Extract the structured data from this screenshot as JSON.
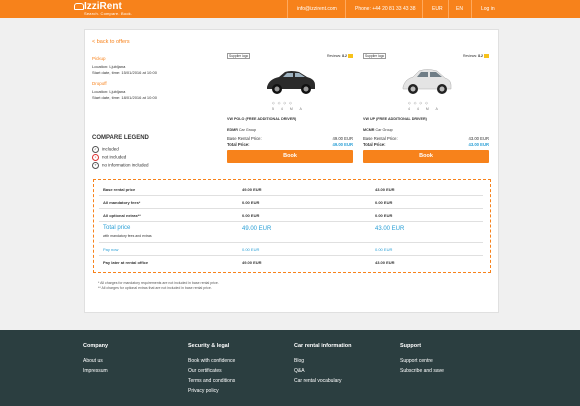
{
  "header": {
    "brand": "IzziRent",
    "tagline": "Search. Compare. Book.",
    "email": "info@izzirent.com",
    "phone": "Phone: +44 20 81 33 43 38",
    "currency": "EUR",
    "language": "EN",
    "login": "Log in"
  },
  "back_link": "< back to offers",
  "pickup": {
    "title": "Pickup",
    "location": "Location: Ljubljana",
    "datetime": "Start date, time: 15/01/2016 at 10:00"
  },
  "dropoff": {
    "title": "Dropoff",
    "location": "Location: Ljubljana",
    "datetime": "Start date, time: 18/01/2016 at 10:00"
  },
  "legend": {
    "title": "COMPARE LEGEND",
    "included": "included",
    "not_included": "not included",
    "no_info": "no information included"
  },
  "cars": [
    {
      "supplier": "Supplier logo",
      "reviews_label": "Reviews:",
      "rating": "8.2",
      "name": "VW POLO (FREE ADDITIONAL DRIVER)",
      "group_code": "EDMR",
      "group_label": "Car Group",
      "base_label": "Base Rental Price:",
      "base_price": "49.00 EUR",
      "total_label": "Total Price:",
      "total_price": "49.00 EUR",
      "book": "Book",
      "color": "#2b2b2b"
    },
    {
      "supplier": "Supplier logo",
      "reviews_label": "Reviews:",
      "rating": "8.2",
      "name": "VW UP (FREE ADDITIONAL DRIVER)",
      "group_code": "MCMR",
      "group_label": "Car Group",
      "base_label": "Base Rental Price:",
      "base_price": "43.00 EUR",
      "total_label": "Total Price:",
      "total_price": "43.00 EUR",
      "book": "Book",
      "color": "#e8e8e8"
    }
  ],
  "table": [
    {
      "label": "Base rental price",
      "a": "49.00 EUR",
      "b": "43.00 EUR"
    },
    {
      "label": "All mandatory fees*",
      "a": "0.00 EUR",
      "b": "0.00 EUR"
    },
    {
      "label": "All optional extras**",
      "a": "0.00 EUR",
      "b": "0.00 EUR"
    },
    {
      "label": "Total price",
      "sub": "with mandatory fees and extras",
      "a": "49.00 EUR",
      "b": "43.00 EUR"
    },
    {
      "label": "Pay now",
      "a": "0.00 EUR",
      "b": "0.00 EUR"
    },
    {
      "label": "Pay later at rental office",
      "a": "49.00 EUR",
      "b": "43.00 EUR"
    }
  ],
  "notes": [
    "* All charges for mandatory requirements are not included in base rental price.",
    "** All charges for optional extras that are not included in base rental price."
  ],
  "footer": {
    "company": {
      "title": "Company",
      "links": [
        "About us",
        "Impressum"
      ]
    },
    "security": {
      "title": "Security & legal",
      "links": [
        "Book with confidence",
        "Our certificates",
        "Terms and conditions",
        "Privacy policy"
      ]
    },
    "info": {
      "title": "Car rental information",
      "links": [
        "Blog",
        "Q&A",
        "Car rental vocabulary"
      ]
    },
    "support": {
      "title": "Support",
      "links": [
        "Support centre",
        "Subscribe and save"
      ]
    }
  }
}
